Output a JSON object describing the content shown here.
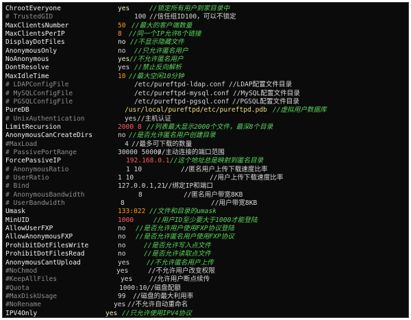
{
  "lines": [
    {
      "key": "ChrootEveryone",
      "value": "yes",
      "comment": "//锁定所有用户到家目录中"
    },
    {
      "key": "# TrustedGID",
      "value": "100",
      "comment": "//信任组ID100，可以不锁定"
    },
    {
      "key": "MaxClientsNumber",
      "value": "50",
      "comment": "//最大的客户端数量"
    },
    {
      "key": "MaxClientsPerIP",
      "value": "8",
      "comment": "//同一个IP允许8个链接"
    },
    {
      "key": "DisplayDotFiles",
      "value": "no",
      "comment": "//不显示隐藏文件"
    },
    {
      "key": "AnonymousOnly",
      "value": "no",
      "comment": "//只允许匿名用户"
    },
    {
      "key": "NoAnonymous",
      "value": "yes",
      "comment": "//不允许匿名用户"
    },
    {
      "key": "DontResolve",
      "value": "yes",
      "comment": "//禁止反向解析"
    },
    {
      "key": "MaxIdleTime",
      "value": "10",
      "comment": "//最大空闲10分钟"
    },
    {
      "key": "# LDAPConfigFile",
      "value": "/etc/pureftpd-ldap.conf",
      "comment": "//LDAP配置文件目录"
    },
    {
      "key": "# MySQLConfigFile",
      "value": "/etc/pureftpd-mysql.conf",
      "comment": "//MySQL配置文件目录"
    },
    {
      "key": "# PGSQLConfigFile",
      "value": "/etc/pureftpd-pgsql.conf",
      "comment": "//PGSQL配置文件目录"
    },
    {
      "key": "PureDB",
      "value": "/usr/local/pureftpd/etc/pureftpd.pdb",
      "comment": "//虚拟用户数据库"
    },
    {
      "key": "# UnixAuthentication",
      "value": "yes",
      "comment": "//主机认证"
    },
    {
      "key": "LimitRecursion",
      "value": "2000 8",
      "comment": "//列表最大显示2000个文件，最深8个目录"
    },
    {
      "key": "AnonymousCanCreateDirs",
      "value": "no",
      "comment": "//是否允许匿名用户创建目录"
    },
    {
      "key": "#MaxLoad",
      "value": "4",
      "comment": "//最多可下载的数量"
    },
    {
      "key": "# PassivePortRange",
      "value": "30000 50000",
      "comment": "//主动连接的端口范围"
    },
    {
      "key": "ForcePassiveIP",
      "value": "192.168.0.1",
      "comment": "//这个地址总是映射到匿名目录"
    },
    {
      "key": "# AnonymousRatio",
      "value": "1 10",
      "comment": "//匿名用户上传下载速度比率"
    },
    {
      "key": "# UserRatio",
      "value": "1 10",
      "comment": "//用户上传下载速度比率"
    },
    {
      "key": "# Bind",
      "value": "127.0.0.1,21",
      "comment": "//绑定IP和端口"
    },
    {
      "key": "# AnonymousBandwidth",
      "value": "8",
      "comment": "//匿名用户带宽8KB"
    },
    {
      "key": "# UserBandwidth",
      "value": "8",
      "comment": "//用户带宽8KB"
    },
    {
      "key": "Umask",
      "value": "133:022",
      "comment": "//文件和目录的umask"
    },
    {
      "key": "MinUID",
      "value": "1000",
      "comment": "//用户ID至少要大于1000才能登陆"
    },
    {
      "key": "AllowUserFXP",
      "value": "no",
      "comment": "//是否允许用户使用FXP协议登陆"
    },
    {
      "key": "AllowAnonymousFXP",
      "value": "no",
      "comment": "//是否允许匿名用户使用FXP协议"
    },
    {
      "key": "ProhibitDotFilesWrite",
      "value": "no",
      "comment": "//是否允许写入点文件"
    },
    {
      "key": "ProhibitDotFilesRead",
      "value": "no",
      "comment": "//是否允许读取点文件"
    },
    {
      "key": "AnonymousCantUpload",
      "value": "yes",
      "comment": "//不允许匿名用户上传"
    },
    {
      "key": "#NoChmod",
      "value": "yes",
      "comment": "//不允许用户改变权限"
    },
    {
      "key": "#KeepAllFiles",
      "value": "yes",
      "comment": "//允许用户断点续传"
    },
    {
      "key": "#Quota",
      "value": "1000:10",
      "comment": "//磁盘配额"
    },
    {
      "key": "#MaxDiskUsage",
      "value": "99",
      "comment": "//磁盘的最大利用率"
    },
    {
      "key": "#NoRename",
      "value": "yes",
      "comment": "//不允许自动重命名"
    },
    {
      "key": "IPV4Only",
      "value": "yes",
      "comment": "//只允许使用IPV4协议"
    }
  ]
}
